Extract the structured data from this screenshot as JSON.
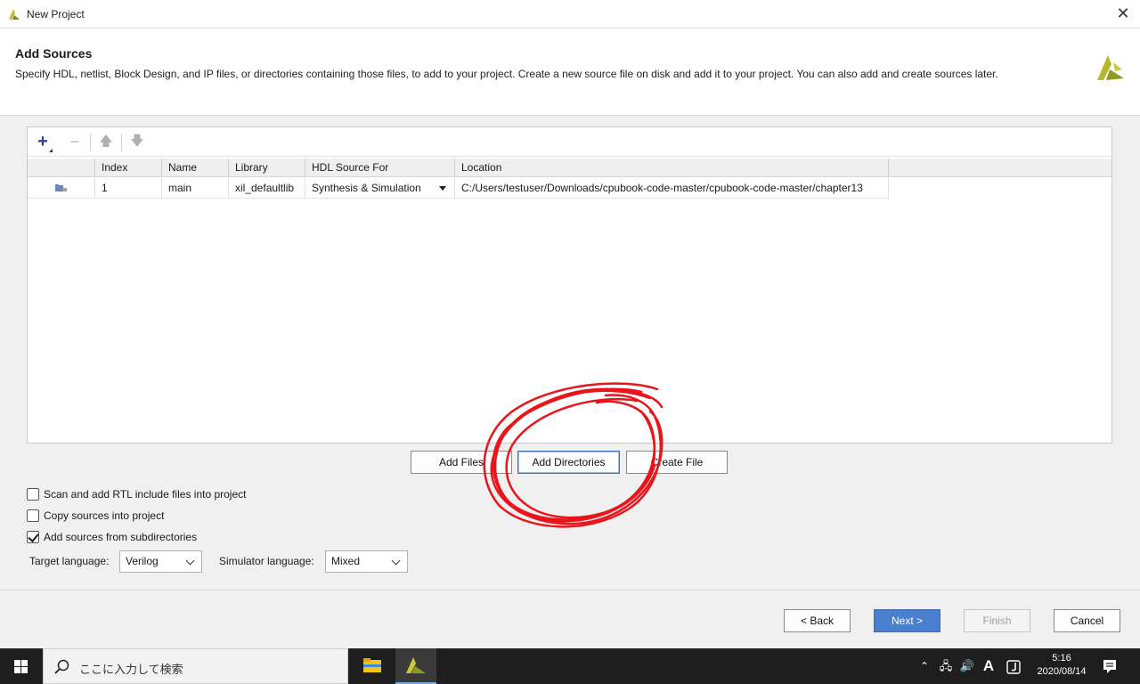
{
  "window": {
    "title": "New Project"
  },
  "header": {
    "title": "Add Sources",
    "description": "Specify HDL, netlist, Block Design, and IP files, or directories containing those files, to add to your project. Create a new source file on disk and add it to your project. You can also add and create sources later."
  },
  "sources_table": {
    "columns": [
      "",
      "Index",
      "Name",
      "Library",
      "HDL Source For",
      "Location"
    ],
    "rows": [
      {
        "index": "1",
        "name": "main",
        "library": "xil_defaultlib",
        "hdl_source_for": "Synthesis & Simulation",
        "location": "C:/Users/testuser/Downloads/cpubook-code-master/cpubook-code-master/chapter13"
      }
    ]
  },
  "action_buttons": {
    "add_files": "Add Files",
    "add_directories": "Add Directories",
    "create_file": "Create File"
  },
  "options": {
    "scan_rtl": {
      "label": "Scan and add RTL include files into project",
      "checked": false
    },
    "copy_sources": {
      "label": "Copy sources into project",
      "checked": false
    },
    "add_subdirs": {
      "label": "Add sources from subdirectories",
      "checked": true
    }
  },
  "languages": {
    "target_label": "Target language:",
    "target_value": "Verilog",
    "simulator_label": "Simulator language:",
    "simulator_value": "Mixed"
  },
  "footer": {
    "back": "< Back",
    "next": "Next >",
    "finish": "Finish",
    "cancel": "Cancel"
  },
  "taskbar": {
    "search_placeholder": "ここに入力して検索",
    "ime_indicator": "A",
    "time": "5:16",
    "date": "2020/08/14"
  },
  "colors": {
    "accent": "#4a7fd0",
    "annotation": "#e8151b",
    "logo": "#b5b82a"
  }
}
